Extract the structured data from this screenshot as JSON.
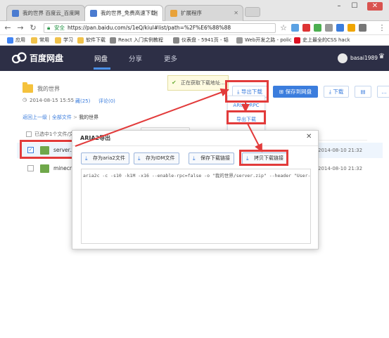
{
  "browser": {
    "tabs": [
      {
        "title": "我的世界 百度云_百度网"
      },
      {
        "title": "我的世界_免费高速下载|"
      },
      {
        "title": "扩展程序"
      }
    ],
    "secure_label": "安全",
    "url": "https://pan.baidu.com/s/1eQ/kiul#list/path=%2F%E6%88%88",
    "bookmarks": [
      "应用",
      "常用",
      "学习",
      "软件下载",
      "React 入门实例教程",
      "仪表盘 - 5941页 - 韬",
      "Web开发之路 - polic",
      "史上最全的CSS hack"
    ]
  },
  "pan": {
    "logo_text": "百度网盘",
    "nav": [
      "网盘",
      "分享",
      "更多"
    ],
    "username": "basai1989"
  },
  "share": {
    "folder_name": "我的世界",
    "date": "2014-08-15 15:55",
    "favorites": "藏(25)",
    "comments": "评论(0)",
    "export_button": "导出下载",
    "save_button": "保存到网盘",
    "download_button": "下载",
    "tooltip": "正在获取下载地址..."
  },
  "export_menu": [
    "ARIA2 RPC",
    "导出下载",
    "设置"
  ],
  "breadcrumb": {
    "back": "返回上一级",
    "all": "全部文件",
    "current": "我的世界"
  },
  "file_list": {
    "header": "已选中1个文件/文",
    "rows": [
      {
        "name": "server.z",
        "date": "2014-08-10 21:32",
        "checked": true
      },
      {
        "name": "minecraf",
        "date": "2014-08-10 21:32",
        "checked": false
      }
    ]
  },
  "dialog": {
    "title": "ARIA2导出",
    "buttons": [
      "存为aria2文件",
      "存为IDM文件",
      "保存下载链接",
      "拷贝下载链接"
    ],
    "command": "aria2c -c -s10 -k1M -x16 --enable-rpc=false -o \"我的世界/server.zip\" --header \"User-Agent: netc"
  },
  "colors": {
    "header_bg": "#2d2f46",
    "accent": "#3b7ddd",
    "highlight": "#e23b3b"
  }
}
